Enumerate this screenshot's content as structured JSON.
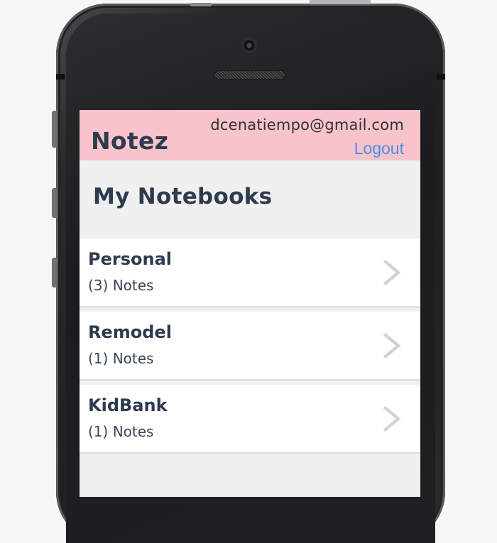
{
  "app": {
    "title": "Notez",
    "user_email": "dcenatiempo@gmail.com",
    "logout_label": "Logout"
  },
  "main": {
    "page_title": "My Notebooks",
    "notebooks": [
      {
        "name": "Personal",
        "count_text": "(3) Notes"
      },
      {
        "name": "Remodel",
        "count_text": "(1) Notes"
      },
      {
        "name": "KidBank",
        "count_text": "(1) Notes"
      }
    ]
  },
  "icons": {
    "row_action": "chevron-right-icon"
  },
  "colors": {
    "header_bg": "#f7c4cc",
    "link": "#4a8ee6",
    "text_dark": "#2d3b4e",
    "screen_bg": "#f0f0f0",
    "chevron": "#d3d3d3"
  }
}
